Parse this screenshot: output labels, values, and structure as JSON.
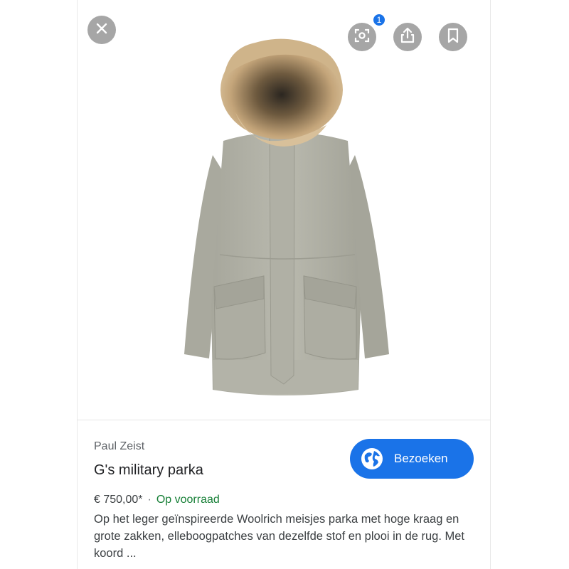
{
  "top_actions": {
    "close_icon": "close-icon",
    "lens_icon": "lens-search-icon",
    "lens_badge": "1",
    "share_icon": "share-icon",
    "save_icon": "bookmark-icon"
  },
  "product": {
    "image_alt": "parka",
    "seller": "Paul Zeist",
    "title": "G's military parka",
    "price": "€ 750,00*",
    "separator": "·",
    "stock_status": "Op voorraad",
    "description": "Op het leger geïnspireerde Woolrich meisjes parka met hoge kraag en grote zakken, elleboogpatches van dezelfde stof en plooi in de rug. Met koord ..."
  },
  "visit_button": {
    "label": "Bezoeken",
    "icon": "globe-icon"
  },
  "colors": {
    "accent": "#1a73e8",
    "stock_green": "#188038",
    "icon_button_bg": "#a6a6a6"
  }
}
